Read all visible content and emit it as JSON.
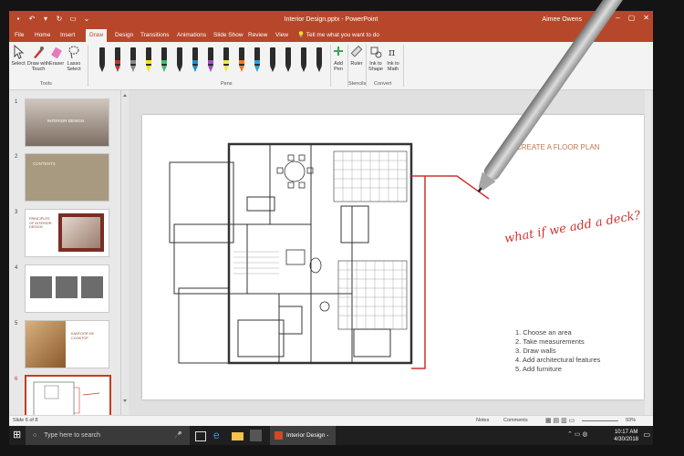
{
  "titlebar": {
    "doc_title": "Interior Design.pptx  -  PowerPoint",
    "user": "Aimee Owens"
  },
  "tabs": [
    "File",
    "Home",
    "Insert",
    "Draw",
    "Design",
    "Transitions",
    "Animations",
    "Slide Show",
    "Review",
    "View"
  ],
  "active_tab": "Draw",
  "tell_me": "Tell me what you want to do",
  "ribbon": {
    "tools": {
      "select": "Select",
      "draw_touch": "Draw with Touch",
      "eraser": "Eraser",
      "lasso": "Lasso Select",
      "group": "Tools"
    },
    "pens_group": "Pens",
    "pens": [
      {
        "color": "#2b2b2b"
      },
      {
        "color": "#c0392b"
      },
      {
        "color": "#888888"
      },
      {
        "color": "#f5e21a"
      },
      {
        "color": "#3ec16a"
      },
      {
        "color": "#2b2b2b"
      },
      {
        "color": "#1a8fd0"
      },
      {
        "color": "#a44cc7"
      },
      {
        "color": "#f0e54a"
      },
      {
        "color": "#f07a24"
      },
      {
        "color": "#2ca1e0"
      },
      {
        "color": "#2b2b2b"
      },
      {
        "color": "#2b2b2b"
      },
      {
        "color": "#2b2b2b"
      },
      {
        "color": "#2b2b2b"
      }
    ],
    "add_pen": "Add Pen",
    "ruler": "Ruler",
    "stencils_group": "Stencils",
    "ink_to_shape": "Ink to Shape",
    "ink_to_math": "Ink to Math",
    "convert_group": "Convert"
  },
  "thumbnails": [
    {
      "num": "1",
      "title": "INTERIOR DESIGN"
    },
    {
      "num": "2",
      "title": "CONTENTS"
    },
    {
      "num": "3",
      "title": "PRINCIPLES OF INTERIOR DESIGN"
    },
    {
      "num": "4",
      "title": ""
    },
    {
      "num": "5",
      "title": "KANTOOR DE COOKTOP"
    },
    {
      "num": "6",
      "title": ""
    }
  ],
  "slide": {
    "title": "CREATE A FLOOR PLAN",
    "handwriting": "what if we add a deck?",
    "steps": [
      "1. Choose an area",
      "2. Take measurements",
      "3. Draw walls",
      "4. Add architectural features",
      "5. Add furniture"
    ]
  },
  "status": {
    "slide_of": "Slide 6 of 8",
    "notes": "Notes",
    "comments": "Comments",
    "zoom": "93%"
  },
  "taskbar": {
    "search_placeholder": "Type here to search",
    "app_label": "Interior Design - P...",
    "time": "10:17 AM",
    "date": "4/30/2018"
  },
  "colors": {
    "accent": "#b7472a",
    "ink_red": "#d0312d"
  }
}
